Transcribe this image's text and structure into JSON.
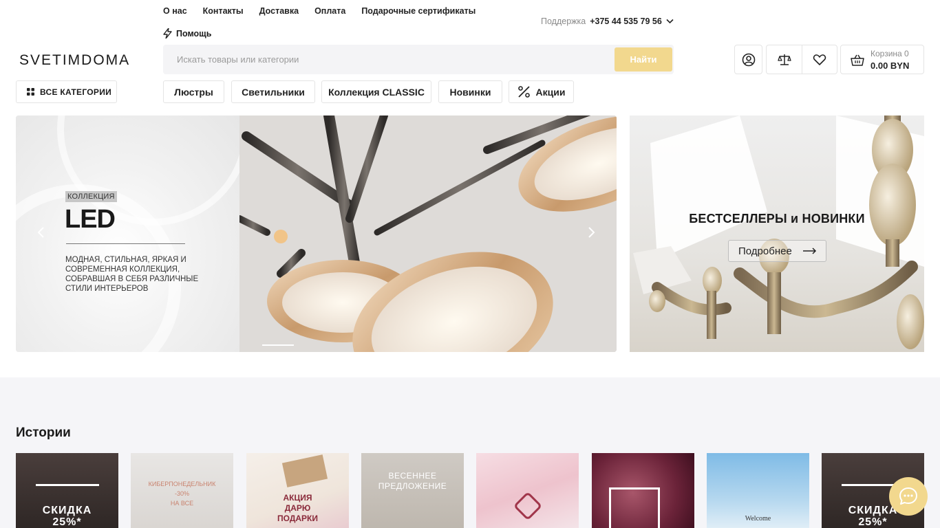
{
  "header": {
    "top_links": [
      "О нас",
      "Контакты",
      "Доставка",
      "Оплата",
      "Подарочные сертификаты"
    ],
    "help_label": "Помощь",
    "support_label": "Поддержка",
    "support_phone": "+375 44 535 79 56",
    "logo": "SVETIMDOMA",
    "search_placeholder": "Искать товары или категории",
    "search_button": "Найти",
    "cart_label": "Корзина 0",
    "cart_total": "0.00 BYN"
  },
  "nav": {
    "all_categories": "ВСЕ КАТЕГОРИИ",
    "items": [
      "Люстры",
      "Светильники",
      "Коллекция CLASSIC",
      "Новинки",
      "Акции"
    ]
  },
  "hero_main": {
    "tag": "КОЛЛЕКЦИЯ",
    "title": "LED",
    "description": "МОДНАЯ, СТИЛЬНАЯ, ЯРКАЯ И СОВРЕМЕННАЯ КОЛЛЕКЦИЯ, СОБРАВШАЯ В СЕБЯ РАЗЛИЧНЫЕ СТИЛИ ИНТЕРЬЕРОВ"
  },
  "hero_side": {
    "title": "БЕСТСЕЛЛЕРЫ и НОВИНКИ",
    "button": "Подробнее"
  },
  "stories": {
    "title": "Истории",
    "items": [
      {
        "text": "СКИДКА\n25%*"
      },
      {
        "text": "КИБЕРПОНЕДЕЛЬНИК\n-30%\nНА ВСЕ"
      },
      {
        "text": "АКЦИЯ\nДАРЮ\nПОДАРКИ"
      },
      {
        "text": "ВЕСЕННЕЕ\nПРЕДЛОЖЕНИЕ"
      },
      {
        "text": ""
      },
      {
        "text": ""
      },
      {
        "text": "Welcome"
      },
      {
        "text": "СКИДКА\n25%*"
      }
    ]
  },
  "colors": {
    "accent": "#f2d88e",
    "stories_bg": "#f5f5f8"
  }
}
